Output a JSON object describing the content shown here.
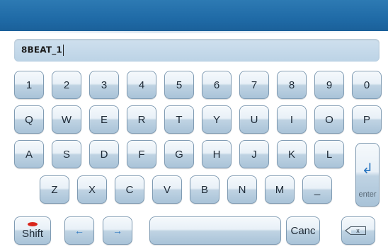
{
  "input": {
    "value": "8BEAT_1"
  },
  "rows": {
    "numbers": [
      "1",
      "2",
      "3",
      "4",
      "5",
      "6",
      "7",
      "8",
      "9",
      "0"
    ],
    "row_q": [
      "Q",
      "W",
      "E",
      "R",
      "T",
      "Y",
      "U",
      "I",
      "O",
      "P"
    ],
    "row_a": [
      "A",
      "S",
      "D",
      "F",
      "G",
      "H",
      "J",
      "K",
      "L"
    ],
    "row_z": [
      "Z",
      "X",
      "C",
      "V",
      "B",
      "N",
      "M",
      "_"
    ]
  },
  "keys": {
    "enter_label": "enter",
    "enter_symbol": "↲",
    "shift_label": "Shift",
    "left_arrow": "←",
    "right_arrow": "→",
    "space_label": "",
    "cancel_label": "Canc",
    "backspace_symbol": "x"
  },
  "colors": {
    "topbar": "#1f6aa6",
    "input_bg": "#c4d8e9",
    "key_accent": "#2a76c0",
    "shift_indicator": "#d9261c"
  }
}
